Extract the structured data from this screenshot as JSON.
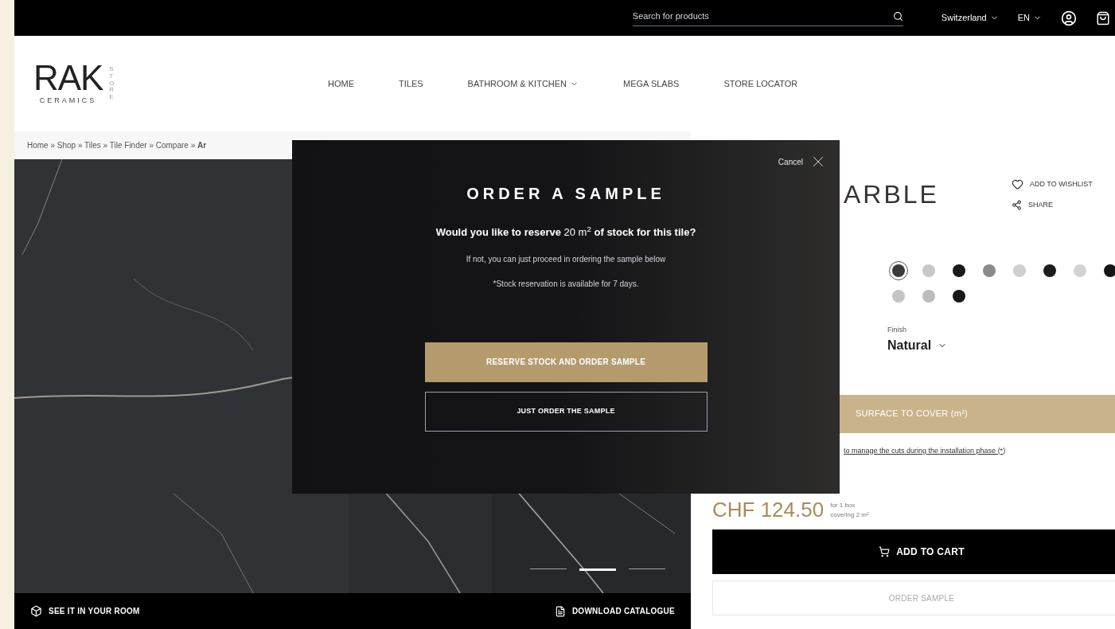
{
  "topbar": {
    "search": {
      "placeholder": "Search for products"
    },
    "country": "Switzerland",
    "language": "EN"
  },
  "header": {
    "logo": {
      "brand": "RAK",
      "sub": "CERAMICS",
      "tag": "STORE"
    },
    "nav": [
      {
        "label": "HOME",
        "dropdown": false
      },
      {
        "label": "TILES",
        "dropdown": false
      },
      {
        "label": "BATHROOM & KITCHEN",
        "dropdown": true
      },
      {
        "label": "MEGA SLABS",
        "dropdown": false
      },
      {
        "label": "STORE LOCATOR",
        "dropdown": false
      }
    ]
  },
  "breadcrumb": "Home » Shop » Tiles » Tile Finder » Compare » **Ar**",
  "gallery": {
    "dots": [
      {
        "selected": false
      },
      {
        "selected": true
      },
      {
        "selected": false
      }
    ],
    "actions": [
      "SEE IT IN YOUR ROOM",
      "DOWNLOAD CATALOGUE"
    ]
  },
  "product": {
    "title": "ARBLE",
    "wishlist": "ADD TO WISHLIST",
    "share": "SHARE",
    "swatches": [
      {
        "color": "#3a3a3a",
        "selected": true
      },
      {
        "color": "#c8c8c8",
        "selected": false
      },
      {
        "color": "#1a1a1a",
        "selected": false
      },
      {
        "color": "#8a8a8a",
        "selected": false
      },
      {
        "color": "#cfcfcf",
        "selected": false
      },
      {
        "color": "#1c1c1c",
        "selected": false
      },
      {
        "color": "#d2d2d2",
        "selected": false
      },
      {
        "color": "#151515",
        "selected": false
      },
      {
        "color": "#c4c4c4",
        "selected": false
      },
      {
        "color": "#bcbcbc",
        "selected": false
      },
      {
        "color": "#181818",
        "selected": false
      }
    ],
    "finish": {
      "label": "Finish",
      "value": "Natural"
    },
    "surface_button": "SURFACE TO COVER (m²)",
    "cuts_link": "to manage the cuts during the installation phase (*)",
    "price": "CHF 124.50",
    "price_unit": "for 1 box",
    "coverage": "covering 2 m²",
    "add_to_cart": "ADD TO CART",
    "order_sample": "ORDER SAMPLE"
  },
  "modal": {
    "cancel": "Cancel",
    "title": "ORDER A SAMPLE",
    "question": "**Would you like to reserve** 20 m$^{2}$ **of stock for this tile?**",
    "note": "If not, you can just proceed in ordering the sample below",
    "disclaimer": "*Stock reservation is available for 7 days.",
    "buttons": [
      {
        "label": "RESERVE STOCK AND ORDER SAMPLE",
        "kind": "primary"
      },
      {
        "label": "JUST ORDER THE SAMPLE",
        "kind": "outline"
      }
    ]
  }
}
